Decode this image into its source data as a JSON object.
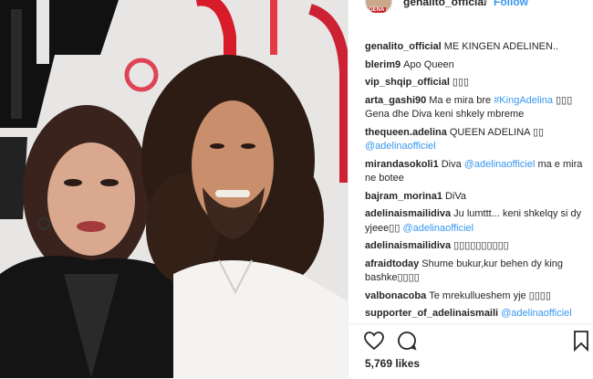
{
  "post": {
    "username": "genalito_official",
    "separator": "•",
    "follow_label": "Follow",
    "avatar_tag": "GENA"
  },
  "comments": [
    {
      "user": "genalito_official",
      "parts": [
        {
          "t": "ME KINGEN ADELINEN.."
        }
      ]
    },
    {
      "user": "blerim9",
      "parts": [
        {
          "t": "Apo Queen"
        }
      ]
    },
    {
      "user": "vip_shqip_official",
      "parts": [
        {
          "t": "▯▯▯"
        }
      ]
    },
    {
      "user": "arta_gashi90",
      "parts": [
        {
          "t": "Ma e mira bre "
        },
        {
          "t": "#KingAdelina",
          "m": true
        },
        {
          "t": " ▯▯▯ Gena dhe Diva keni shkely mbreme"
        }
      ]
    },
    {
      "user": "thequeen.adelina",
      "parts": [
        {
          "t": "QUEEN ADELINA ▯▯ "
        },
        {
          "t": "@adelinaofficiel",
          "m": true
        }
      ]
    },
    {
      "user": "mirandasokoli1",
      "parts": [
        {
          "t": "Diva "
        },
        {
          "t": "@adelinaofficiel",
          "m": true
        },
        {
          "t": " ma e mira ne botee"
        }
      ]
    },
    {
      "user": "bajram_morina1",
      "parts": [
        {
          "t": "DiVa"
        }
      ]
    },
    {
      "user": "adelinaismailidiva",
      "parts": [
        {
          "t": "Ju lumttt... keni shkelqy si dy yjeee▯▯ "
        },
        {
          "t": "@adelinaofficiel",
          "m": true
        }
      ]
    },
    {
      "user": "adelinaismailidiva",
      "parts": [
        {
          "t": "▯▯▯▯▯▯▯▯▯▯"
        }
      ]
    },
    {
      "user": "afraidtoday",
      "parts": [
        {
          "t": "Shume bukur,kur behen dy king bashke▯▯▯▯"
        }
      ]
    },
    {
      "user": "valbonacoba",
      "parts": [
        {
          "t": "Te mrekullueshem yje ▯▯▯▯"
        }
      ]
    },
    {
      "user": "supporter_of_adelinaismaili",
      "parts": [
        {
          "t": "@adelinaofficiel",
          "m": true
        }
      ]
    }
  ],
  "footer": {
    "likes": "5,769 likes",
    "icons": [
      "heart-icon",
      "comment-icon",
      "bookmark-icon"
    ]
  },
  "colors": {
    "link": "#3897f0",
    "text": "#262626",
    "brand_red": "#c62828"
  }
}
